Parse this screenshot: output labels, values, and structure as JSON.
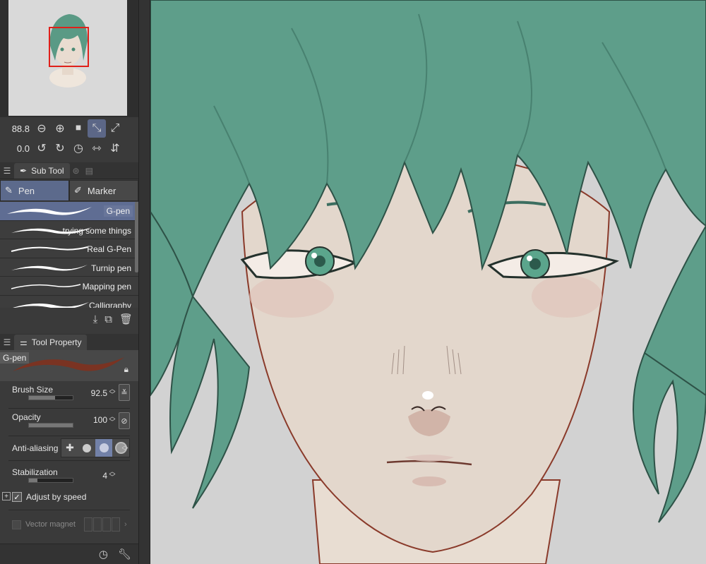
{
  "navigator": {
    "zoom": "88.8",
    "rotation": "0.0"
  },
  "subtool": {
    "tab_label": "Sub Tool",
    "groups": [
      "Pen",
      "Marker"
    ],
    "brushes": [
      "G-pen",
      "trying some things",
      "Real G-Pen",
      "Turnip pen",
      "Mapping pen",
      "Calligraphy"
    ],
    "active_brush_index": 0
  },
  "tool_property": {
    "tab_label": "Tool Property",
    "preview_name": "G-pen",
    "brush_size_label": "Brush Size",
    "brush_size_value": "92.5",
    "brush_size_fraction": 0.6,
    "opacity_label": "Opacity",
    "opacity_value": "100",
    "opacity_fraction": 1.0,
    "antialias_label": "Anti-aliasing",
    "stabilization_label": "Stabilization",
    "stabilization_value": "4",
    "stabilization_fraction": 0.2,
    "adjust_by_speed_label": "Adjust by speed",
    "adjust_by_speed_checked": true,
    "vector_magnet_label": "Vector magnet"
  },
  "colors": {
    "accent": "#5c6a8c",
    "hair": "#5e9e8a",
    "skin": "#e3d7cc",
    "brush_preview": "#7a3322"
  }
}
